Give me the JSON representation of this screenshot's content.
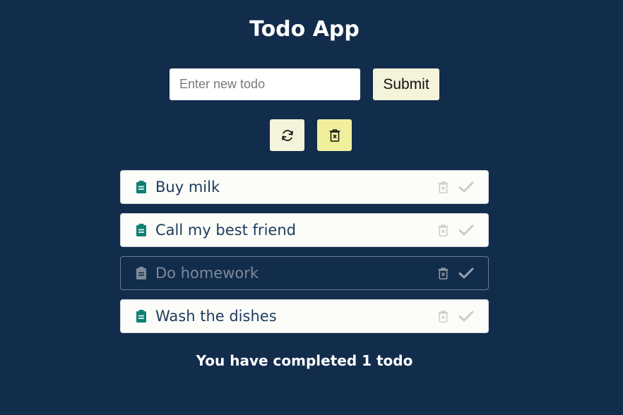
{
  "app": {
    "title": "Todo App"
  },
  "form": {
    "input_placeholder": "Enter new todo",
    "input_value": "",
    "submit_label": "Submit"
  },
  "actions": {
    "refresh_icon": "refresh-icon",
    "clear_icon": "trash-x-icon"
  },
  "todos": [
    {
      "text": "Buy milk",
      "completed": false
    },
    {
      "text": "Call my best friend",
      "completed": false
    },
    {
      "text": "Do homework",
      "completed": true
    },
    {
      "text": "Wash the dishes",
      "completed": false
    }
  ],
  "summary": {
    "text": "You have completed 1 todo"
  },
  "colors": {
    "background": "#122c4c",
    "note_icon": "#0e8074",
    "submit_bg": "#f5f3d9",
    "clear_bg": "#f1ef9c",
    "item_bg": "#fcfdf8"
  }
}
